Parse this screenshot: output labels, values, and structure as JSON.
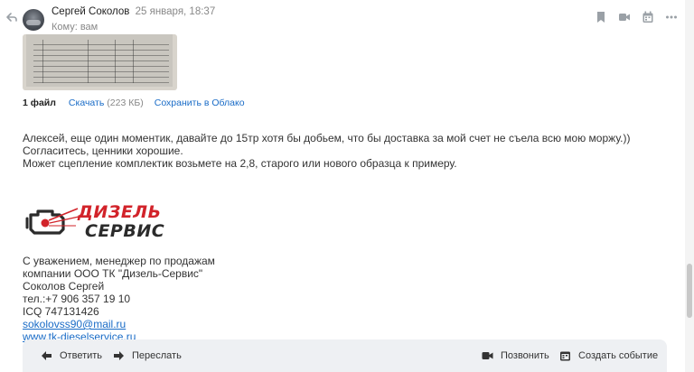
{
  "message": {
    "sender_name": "Сергей Соколов",
    "date": "25 января, 18:37",
    "to_line": "Кому: вам"
  },
  "attachments": {
    "count_label": "1 файл",
    "download_label": "Скачать",
    "size": "(223 КБ)",
    "save_cloud_label": "Сохранить в Облако"
  },
  "body": {
    "paragraph1": "Алексей, еще один моментик, давайте до 15тр хотя бы добьем, что бы доставка за мой счет не съела всю мою моржу.)) Согласитесь, ценники хорошие.",
    "paragraph2": "Может сцепление комплектик возьмете на 2,8, старого или нового образца к примеру."
  },
  "logo": {
    "line1": "ДИЗЕЛЬ",
    "line2": "СЕРВИС",
    "colors": {
      "red": "#d2232a",
      "dark": "#2b2b2b"
    }
  },
  "signature": {
    "line1": "С уважением, менеджер по продажам",
    "line2": "компании ООО ТК \"Дизель-Сервис\"",
    "line3": "Соколов Сергей",
    "phone": "тел.:+7 906 357 19 10",
    "icq": "ICQ 747131426",
    "email": "sokolovss90@mail.ru",
    "website": "www.tk-dieselservice.ru"
  },
  "actions": {
    "reply": "Ответить",
    "forward": "Переслать",
    "call": "Позвонить",
    "create_event": "Создать событие"
  },
  "header_icons": [
    "bookmark-icon",
    "video-icon",
    "calendar-icon",
    "more-icon"
  ],
  "accent_color": "#1a6cc7"
}
